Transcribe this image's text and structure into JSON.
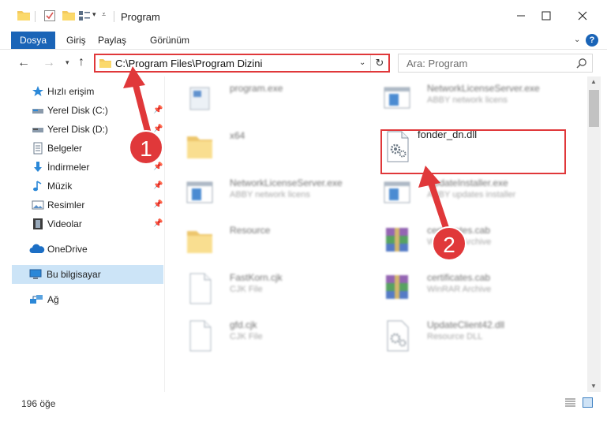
{
  "window": {
    "title": "Program",
    "minimize": "—",
    "maximize": "☐",
    "close": "✕"
  },
  "ribbon": {
    "tabs": [
      "Dosya",
      "Giriş",
      "Paylaş",
      "Görünüm"
    ],
    "help": "?"
  },
  "address": {
    "path": "C:\\Program Files\\Program Dizini",
    "search_placeholder": "Ara: Program"
  },
  "sidebar": {
    "items": [
      {
        "label": "Hızlı erişim",
        "icon": "star-icon"
      },
      {
        "label": "Yerel Disk (C:)",
        "icon": "drive-icon",
        "pinned": true
      },
      {
        "label": "Yerel Disk (D:)",
        "icon": "drive-icon",
        "pinned": true
      },
      {
        "label": "Belgeler",
        "icon": "documents-icon",
        "pinned": true
      },
      {
        "label": "İndirmeler",
        "icon": "download-icon",
        "pinned": true
      },
      {
        "label": "Müzik",
        "icon": "music-icon",
        "pinned": true
      },
      {
        "label": "Resimler",
        "icon": "pictures-icon",
        "pinned": true
      },
      {
        "label": "Videolar",
        "icon": "video-icon",
        "pinned": true
      },
      {
        "label": "OneDrive",
        "icon": "cloud-icon"
      },
      {
        "label": "Bu bilgisayar",
        "icon": "computer-icon",
        "selected": true
      },
      {
        "label": "Ağ",
        "icon": "network-icon"
      }
    ]
  },
  "files": [
    {
      "name": "program.exe",
      "desc": "",
      "icon": "exe-icon"
    },
    {
      "name": "NetworkLicenseServer.exe",
      "desc": "ABBY network licens",
      "icon": "exe-window-icon"
    },
    {
      "name": "x64",
      "desc": "",
      "icon": "folder-icon"
    },
    {
      "name": "fonder_dn.dll",
      "desc": "",
      "icon": "dll-gear-icon"
    },
    {
      "name": "NetworkLicenseServer.exe",
      "desc": "ABBY network licens",
      "icon": "exe-window-icon"
    },
    {
      "name": "UpdateInstaller.exe",
      "desc": "ABBY updates installer",
      "icon": "exe-window-icon"
    },
    {
      "name": "Resource",
      "desc": "",
      "icon": "folder-icon"
    },
    {
      "name": "certificates.cab",
      "desc": "WinRAR Archive",
      "icon": "winrar-icon"
    },
    {
      "name": "FastKorn.cjk",
      "desc": "CJK File",
      "icon": "blank-file-icon"
    },
    {
      "name": "certificates.cab",
      "desc": "WinRAR Archive",
      "icon": "winrar-icon"
    },
    {
      "name": "gfd.cjk",
      "desc": "CJK File",
      "icon": "blank-file-icon"
    },
    {
      "name": "UpdateClient42.dll",
      "desc": "Resource DLL",
      "icon": "dll-gear-icon"
    }
  ],
  "annotations": {
    "badge1": "1",
    "badge2": "2",
    "color": "#e0383a"
  },
  "status": {
    "count": "196 öğe"
  },
  "colors": {
    "accent": "#1a64b7",
    "selected": "#cce4f7",
    "annotation": "#e0383a"
  }
}
